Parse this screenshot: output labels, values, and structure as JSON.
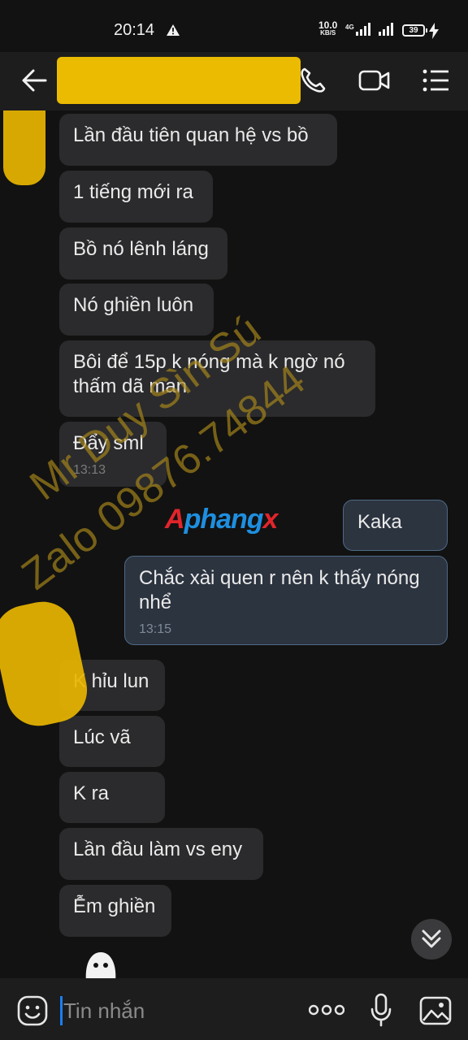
{
  "status_bar": {
    "time": "20:14",
    "net_speed_value": "10.0",
    "net_speed_unit": "KB/S",
    "network": "4G",
    "battery": "39"
  },
  "header": {
    "contact_name_redacted": true,
    "icons": [
      "back-arrow-icon",
      "phone-icon",
      "video-call-icon",
      "menu-icon"
    ]
  },
  "watermark": {
    "line1": "Mr Duy Sìn Sú",
    "line2": "Zalo 09876.74844"
  },
  "logo": {
    "part1": "A",
    "part2": "phang",
    "part3": "x"
  },
  "messages": [
    {
      "dir": "in",
      "text": "Lần đầu tiên quan hệ vs bồ",
      "time": ""
    },
    {
      "dir": "in",
      "text": "1 tiếng mới ra",
      "time": ""
    },
    {
      "dir": "in",
      "text": "Bồ nó lênh láng",
      "time": ""
    },
    {
      "dir": "in",
      "text": "Nó ghiền luôn",
      "time": ""
    },
    {
      "dir": "in",
      "text": "Bôi để 15p k nóng mà k ngờ nó thấm dã man",
      "time": ""
    },
    {
      "dir": "in",
      "text": "Đẩy sml",
      "time": "13:13"
    },
    {
      "dir": "out",
      "text": "Kaka",
      "time": ""
    },
    {
      "dir": "out",
      "text": "Chắc xài quen r nên k thấy nóng nhể",
      "time": "13:15"
    },
    {
      "dir": "in",
      "text": "K hỉu lun",
      "time": ""
    },
    {
      "dir": "in",
      "text": "Lúc vã",
      "time": ""
    },
    {
      "dir": "in",
      "text": "K ra",
      "time": ""
    },
    {
      "dir": "in",
      "text": "Lần đầu làm vs eny",
      "time": ""
    },
    {
      "dir": "in",
      "text": "Ễm ghiền",
      "time": ""
    }
  ],
  "composer": {
    "placeholder": "Tin nhắn"
  },
  "colors": {
    "accent": "#1a7ef2",
    "incoming_bubble": "#2b2b2d",
    "outgoing_bubble": "#2c3440",
    "redaction": "#f2c200"
  }
}
